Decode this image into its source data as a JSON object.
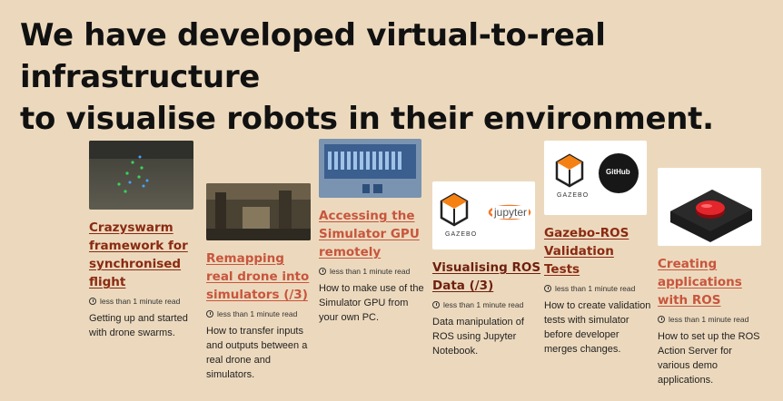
{
  "headline": {
    "line1": "We have developed virtual-to-real infrastructure",
    "line2": "to visualise robots in their environment."
  },
  "cards": [
    {
      "title": "Crazyswarm framework for synchronised flight",
      "meta": "less than 1 minute read",
      "description": "Getting up and started with drone swarms.",
      "image": "drone-swarm-photo"
    },
    {
      "title": "Remapping real drone into simulators (/3)",
      "meta": "less than 1 minute read",
      "description": "How to transfer inputs and outputs between a real drone and simulators.",
      "image": "simulator-render"
    },
    {
      "title": "Accessing the Simulator GPU remotely",
      "meta": "less than 1 minute read",
      "description": "How to make use of the Simulator GPU from your own PC.",
      "image": "gpu-server-photo"
    },
    {
      "title": "Visualising ROS Data (/3)",
      "meta": "less than 1 minute read",
      "description": "Data manipulation of ROS using Jupyter Notebook.",
      "image": "gazebo-jupyter-logos",
      "logo_left": "GAZEBO",
      "logo_right": "jupyter"
    },
    {
      "title": "Gazebo-ROS Validation Tests",
      "meta": "less than 1 minute read",
      "description": "How to create validation tests with simulator before developer merges changes.",
      "image": "gazebo-github-logos",
      "logo_left": "GAZEBO",
      "logo_right": "GitHub"
    },
    {
      "title": "Creating applications with ROS",
      "meta": "less than 1 minute read",
      "description": "How to set up the ROS Action Server for various demo applications.",
      "image": "red-button-photo"
    }
  ]
}
